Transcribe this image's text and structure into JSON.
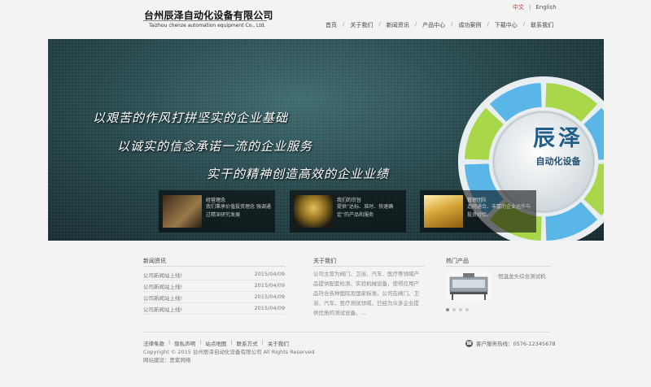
{
  "header": {
    "company_cn": "台州辰泽自动化设备有限公司",
    "company_en": "Taizhou chenze automation equipment Co., Ltd.",
    "lang": {
      "cn": "中文",
      "en": "English"
    },
    "nav": [
      "首页",
      "关于我们",
      "新闻资讯",
      "产品中心",
      "成功案例",
      "下载中心",
      "联系我们"
    ]
  },
  "banner": {
    "slogans": [
      "以艰苦的作风打拼坚实的企业基础",
      "以诚实的信念承诺一流的企业服务",
      "实干的精神创造高效的企业业绩"
    ],
    "brand": "辰泽",
    "brand_sub": "自动化设备",
    "cards": [
      {
        "title": "经营理念",
        "desc": "我们秉承价值投资理念 强调通过精深研究发展"
      },
      {
        "title": "我们的宗旨",
        "desc": "提供“达标、准时、快速确定”的产品和服务"
      },
      {
        "title": "管理团队",
        "desc": "造网通合、丰富的企业运作与投资经验。"
      }
    ],
    "ring_colors": [
      "#a8d84a",
      "#5ab6e6"
    ]
  },
  "news": {
    "title": "新闻资讯",
    "items": [
      {
        "title": "公司新闻站上线!",
        "date": "2015/04/09"
      },
      {
        "title": "公司新闻站上线!",
        "date": "2015/04/09"
      },
      {
        "title": "公司新闻站上线!",
        "date": "2015/04/09"
      },
      {
        "title": "公司新闻站上线!",
        "date": "2015/04/09"
      }
    ]
  },
  "about": {
    "title": "关于我们",
    "text": "公司主营为阀门、卫浴、汽车、医疗等领域产品提供配套检测、实验机械设备，使得应用产品符合各种国际及国家标准。公司在阀门、卫浴、汽车、医疗测试领域，已经为众多企业提供优质的测试设备。..."
  },
  "products": {
    "title": "热门产品",
    "item_name": "恒温龙头综合测试机"
  },
  "footer": {
    "links": [
      "法律条款",
      "隐私声明",
      "站点地图",
      "联系方式",
      "关于我们"
    ],
    "copyright": "Copyright © 2015 台州辰泽自动化设备有限公司 All Rights Reserved",
    "support": "网站建设：思紫网络",
    "hotline": "客户服务热线：0576-12345678"
  }
}
